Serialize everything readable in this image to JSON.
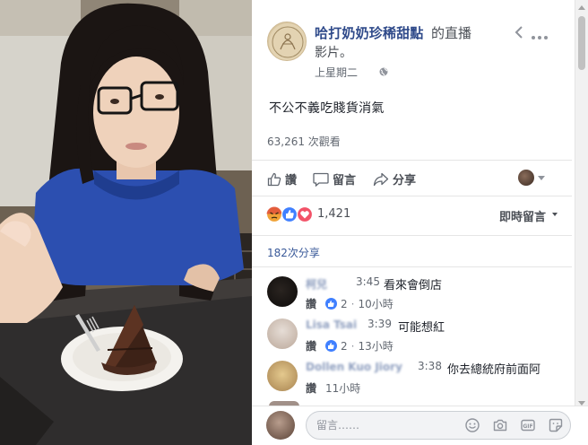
{
  "post": {
    "page_name": "哈打奶奶珍稀甜點",
    "kind_line1": "的直播",
    "kind_line2": "影片。",
    "timestamp": "上星期二",
    "text": "不公不義吃賤貨消氣",
    "views": "63,261 次觀看"
  },
  "actions": {
    "like": "讚",
    "comment": "留言",
    "share": "分享"
  },
  "reactions": {
    "count": "1,421",
    "sort_label": "即時留言",
    "icons": [
      "angry-reaction-icon",
      "like-reaction-icon",
      "love-reaction-icon"
    ]
  },
  "shares": "182次分享",
  "comments": [
    {
      "name": "柯兒",
      "time": "3:45",
      "text": "看來會倒店",
      "like_label": "讚",
      "likes": "2",
      "age": "10小時"
    },
    {
      "name": "Lisa Tsai",
      "time": "3:39",
      "text": "可能想紅",
      "like_label": "讚",
      "likes": "2",
      "age": "13小時"
    },
    {
      "name": "Dollen Kuo Jiory",
      "time": "3:38",
      "text": "你去總統府前面阿",
      "like_label": "讚",
      "likes": "",
      "age": "11小時"
    }
  ],
  "composer": {
    "placeholder": "留言……",
    "icons": [
      "emoji-icon",
      "camera-icon",
      "gif-icon",
      "sticker-icon"
    ]
  },
  "colors": {
    "link_blue": "#385898",
    "page_name": "#2f4a8a",
    "like_blue": "#4080ff",
    "love_red": "#f25268",
    "angry_orange": "#f0a236"
  }
}
